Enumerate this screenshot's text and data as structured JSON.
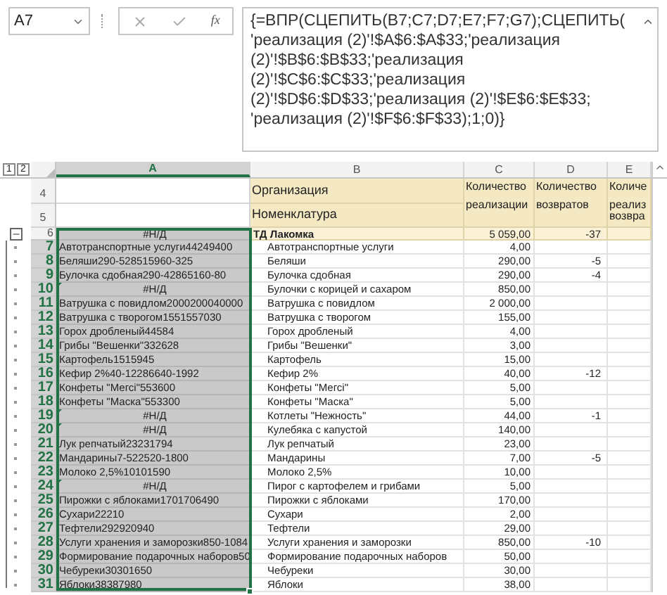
{
  "name_box": "A7",
  "fx_label": "fx",
  "formula": "{=ВПР(СЦЕПИТЬ(B7;C7;D7;E7;F7;G7);СЦЕПИТЬ( 'реализация (2)'!$A$6:$A$33;'реализация (2)'!$B$6:$B$33;'реализация (2)'!$C$6:$C$33;'реализация (2)'!$D$6:$D$33;'реализация (2)'!$E$6:$E$33; 'реализация (2)'!$F$6:$F$33);1;0)}",
  "outline_levels": [
    {
      "label": "1"
    },
    {
      "label": "2"
    }
  ],
  "columns": [
    {
      "label": "A",
      "selected": true
    },
    {
      "label": "B",
      "selected": false
    },
    {
      "label": "C",
      "selected": false
    },
    {
      "label": "D",
      "selected": false
    },
    {
      "label": "E",
      "selected": false
    }
  ],
  "header_rows": [
    {
      "number": "4",
      "b": "Организация"
    },
    {
      "number": "5",
      "b": "Номенклатура"
    }
  ],
  "measure_headers": [
    {
      "lines": [
        "Количество",
        "реализации"
      ]
    },
    {
      "lines": [
        "Количество",
        "возвратов"
      ]
    },
    {
      "lines": [
        "Количе",
        "реализ",
        "возвра"
      ]
    }
  ],
  "rows": [
    {
      "number": "6",
      "kind": "group",
      "selected": false,
      "a": "#Н/Д",
      "a_error": true,
      "b": "ТД Лакомка",
      "c": "5 059,00",
      "d": "-37"
    },
    {
      "number": "7",
      "kind": "item",
      "selected": true,
      "a": "Автотранспортные услуги44249400",
      "a_error": false,
      "b": "Автотранспортные услуги",
      "c": "4,00"
    },
    {
      "number": "8",
      "kind": "item",
      "selected": true,
      "a": "Беляши290-528515960-325",
      "a_error": false,
      "b": "Беляши",
      "c": "290,00",
      "d": "-5"
    },
    {
      "number": "9",
      "kind": "item",
      "selected": true,
      "a": "Булочка сдобная290-42865160-80",
      "a_error": false,
      "b": "Булочка сдобная",
      "c": "290,00",
      "d": "-4"
    },
    {
      "number": "10",
      "kind": "item",
      "selected": true,
      "a": "#Н/Д",
      "a_error": true,
      "b": "Булочки с корицей и сахаром",
      "c": "850,00"
    },
    {
      "number": "11",
      "kind": "item",
      "selected": true,
      "a": "Ватрушка с повидлом2000200040000",
      "a_error": false,
      "b": "Ватрушка с повидлом",
      "c": "2 000,00"
    },
    {
      "number": "12",
      "kind": "item",
      "selected": true,
      "a": "Ватрушка с творогом1551557030",
      "a_error": false,
      "b": "Ватрушка с творогом",
      "c": "155,00"
    },
    {
      "number": "13",
      "kind": "item",
      "selected": true,
      "a": "Горох дробленый44584",
      "a_error": false,
      "b": "Горох дробленый",
      "c": "4,00"
    },
    {
      "number": "14",
      "kind": "item",
      "selected": true,
      "a": "Грибы \"Вешенки\"332628",
      "a_error": false,
      "b": "Грибы \"Вешенки\"",
      "c": "3,00"
    },
    {
      "number": "15",
      "kind": "item",
      "selected": true,
      "a": "Картофель1515945",
      "a_error": false,
      "b": "Картофель",
      "c": "15,00"
    },
    {
      "number": "16",
      "kind": "item",
      "selected": true,
      "a": "Кефир 2%40-12286640-1992",
      "a_error": false,
      "b": "Кефир 2%",
      "c": "40,00",
      "d": "-12"
    },
    {
      "number": "17",
      "kind": "item",
      "selected": true,
      "a": "Конфеты \"Мегсі\"553600",
      "a_error": false,
      "b": "Конфеты \"Мегсі\"",
      "c": "5,00"
    },
    {
      "number": "18",
      "kind": "item",
      "selected": true,
      "a": "Конфеты \"Маска\"553300",
      "a_error": false,
      "b": "Конфеты \"Маска\"",
      "c": "5,00"
    },
    {
      "number": "19",
      "kind": "item",
      "selected": true,
      "a": "#Н/Д",
      "a_error": true,
      "b": "Котлеты \"Нежность\"",
      "c": "44,00",
      "d": "-1"
    },
    {
      "number": "20",
      "kind": "item",
      "selected": true,
      "a": "#Н/Д",
      "a_error": true,
      "b": "Кулебяка с капустой",
      "c": "140,00"
    },
    {
      "number": "21",
      "kind": "item",
      "selected": true,
      "a": "Лук репчатый23231794",
      "a_error": false,
      "b": "Лук репчатый",
      "c": "23,00"
    },
    {
      "number": "22",
      "kind": "item",
      "selected": true,
      "a": "Мандарины7-522520-1800",
      "a_error": false,
      "b": "Мандарины",
      "c": "7,00",
      "d": "-5"
    },
    {
      "number": "23",
      "kind": "item",
      "selected": true,
      "a": "Молоко 2,5%10101590",
      "a_error": false,
      "b": "Молоко 2,5%",
      "c": "10,00"
    },
    {
      "number": "24",
      "kind": "item",
      "selected": true,
      "a": "#Н/Д",
      "a_error": true,
      "b": "Пирог с картофелем и грибами",
      "c": "5,00"
    },
    {
      "number": "25",
      "kind": "item",
      "selected": true,
      "a": "Пирожки с яблоками1701706490",
      "a_error": false,
      "b": "Пирожки с яблоками",
      "c": "170,00"
    },
    {
      "number": "26",
      "kind": "item",
      "selected": true,
      "a": "Сухари22210",
      "a_error": false,
      "b": "Сухари",
      "c": "2,00"
    },
    {
      "number": "27",
      "kind": "item",
      "selected": true,
      "a": "Тефтели292920940",
      "a_error": false,
      "b": "Тефтели",
      "c": "29,00"
    },
    {
      "number": "28",
      "kind": "item",
      "selected": true,
      "a": "Услуги хранения и заморозки850-1084",
      "a_error": false,
      "b": "Услуги хранения и заморозки",
      "c": "850,00",
      "d": "-10"
    },
    {
      "number": "29",
      "kind": "item",
      "selected": true,
      "a": "Формирование подарочных наборов50",
      "a_error": false,
      "b": "Формирование подарочных наборов",
      "c": "50,00"
    },
    {
      "number": "30",
      "kind": "item",
      "selected": true,
      "a": "Чебуреки30301650",
      "a_error": false,
      "b": "Чебуреки",
      "c": "30,00"
    },
    {
      "number": "31",
      "kind": "item",
      "selected": true,
      "a": "Яблоки38387980",
      "a_error": false,
      "b": "Яблоки",
      "c": "38,00"
    }
  ]
}
